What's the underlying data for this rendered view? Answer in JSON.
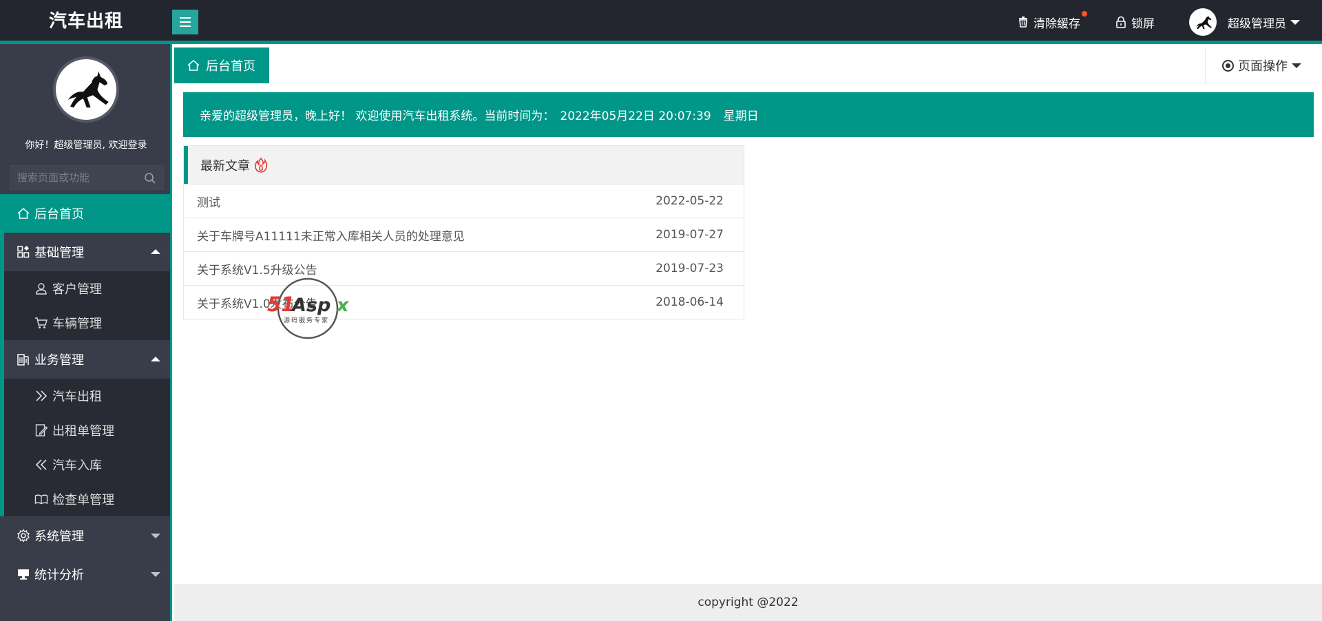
{
  "header": {
    "logo": "汽车出租",
    "clear_cache": "清除缓存",
    "lock_screen": "锁屏",
    "user_name": "超级管理员"
  },
  "sidebar": {
    "welcome": "你好！超级管理员, 欢迎登录",
    "search_placeholder": "搜索页面或功能",
    "home": "后台首页",
    "groups": [
      {
        "label": "基础管理",
        "items": [
          "客户管理",
          "车辆管理"
        ]
      },
      {
        "label": "业务管理",
        "items": [
          "汽车出租",
          "出租单管理",
          "汽车入库",
          "检查单管理"
        ]
      }
    ],
    "system": "系统管理",
    "stats": "统计分析"
  },
  "tabs": {
    "home": "后台首页",
    "page_ops": "页面操作"
  },
  "greeting": {
    "prefix": "亲爱的超级管理员，晚上好！ 欢迎使用汽车出租系统。当前时间为：",
    "datetime": "2022年05月22日 20:07:39",
    "weekday": "星期日"
  },
  "articles": {
    "title": "最新文章",
    "rows": [
      {
        "title": "测试",
        "date": "2022-05-22"
      },
      {
        "title": "关于车牌号A11111未正常入库相关人员的处理意见",
        "date": "2019-07-27"
      },
      {
        "title": "关于系统V1.5升级公告",
        "date": "2019-07-23"
      },
      {
        "title": "关于系统V1.0发布公告",
        "date": "2018-06-14"
      }
    ]
  },
  "watermark": {
    "brand": "51Aspx",
    "tagline": "源码服务专家"
  },
  "footer": "copyright @2022",
  "colors": {
    "accent": "#009688",
    "header_bg": "#23262e",
    "sidebar_bg": "#393d49",
    "submenu_bg": "#282b33",
    "badge": "#ff5722"
  }
}
